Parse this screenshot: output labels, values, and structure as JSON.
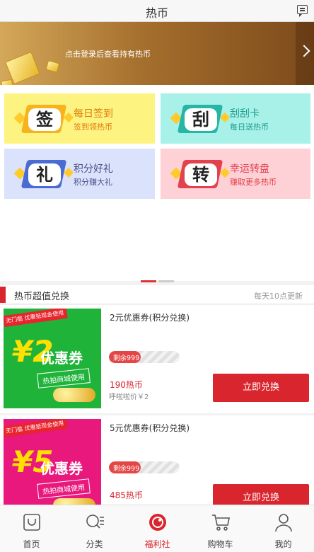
{
  "header": {
    "title": "热币"
  },
  "banner": {
    "login_text": "点击登录后查看持有热币"
  },
  "tiles": [
    {
      "char": "签",
      "title": "每日签到",
      "subtitle": "签到领热币",
      "bg": "#fdf381",
      "accent": "#f7b21c",
      "text_color": "#e07b0a"
    },
    {
      "char": "刮",
      "title": "刮刮卡",
      "subtitle": "每日送热币",
      "bg": "#a8f1e8",
      "accent": "#26b6a6",
      "text_color": "#1e9b8e"
    },
    {
      "char": "礼",
      "title": "积分好礼",
      "subtitle": "积分赚大礼",
      "bg": "#dbe2fb",
      "accent": "#4a6bd1",
      "text_color": "#4a4e88"
    },
    {
      "char": "转",
      "title": "幸运转盘",
      "subtitle": "赚取更多热币",
      "bg": "#fdd1d5",
      "accent": "#e2424e",
      "text_color": "#e2424e"
    }
  ],
  "section": {
    "title": "热币超值兑换",
    "note": "每天10点更新"
  },
  "products": [
    {
      "name": "2元优惠券(积分兑换)",
      "img_bg": "#1fb33a",
      "img_tag": "无门槛 优惠抵现金使用",
      "img_big": "¥2",
      "img_word": "优惠券",
      "img_pill": "热拍商城使用",
      "remain_label": "剩余999",
      "remain_fraction": 0.45,
      "price": "190热币",
      "sub": "呼啦啦价￥2",
      "button": "立即兑换"
    },
    {
      "name": "5元优惠券(积分兑换)",
      "img_bg": "#e8187d",
      "img_tag": "无门槛 优惠抵现金使用",
      "img_big": "¥5",
      "img_word": "优惠券",
      "img_pill": "热拍商城使用",
      "remain_label": "剩余999",
      "remain_fraction": 0.45,
      "price": "485热币",
      "sub": "",
      "button": "立即兑换"
    }
  ],
  "tabbar": [
    {
      "label": "首页",
      "icon": "shopping-bag-icon",
      "active": false
    },
    {
      "label": "分类",
      "icon": "search-list-icon",
      "active": false
    },
    {
      "label": "福利社",
      "icon": "welfare-icon",
      "active": true
    },
    {
      "label": "购物车",
      "icon": "cart-icon",
      "active": false
    },
    {
      "label": "我的",
      "icon": "user-icon",
      "active": false
    }
  ],
  "colors": {
    "accent": "#d9262e",
    "banner": "#a56f2d"
  }
}
